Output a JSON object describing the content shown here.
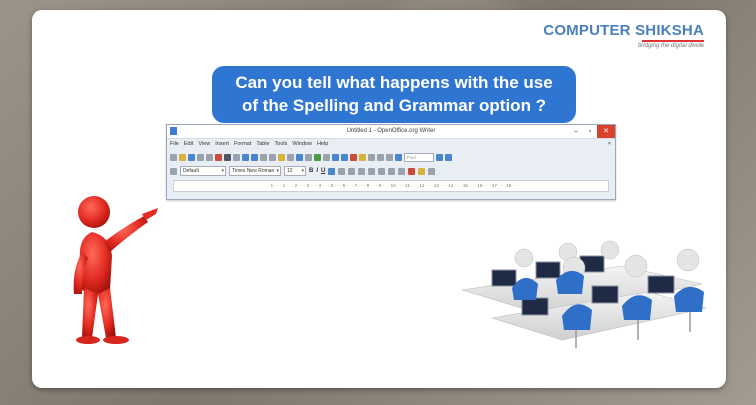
{
  "logo": {
    "main": "COMPUTER SHIKSHA",
    "tagline": "bridging the digital divide"
  },
  "question": {
    "line1": "Can you tell what happens with the use",
    "line2": "of the Spelling and Grammar option ?"
  },
  "writer": {
    "title": "Untitled 1 - OpenOffice.org Writer",
    "menu": [
      "File",
      "Edit",
      "View",
      "Insert",
      "Format",
      "Table",
      "Tools",
      "Window",
      "Help"
    ],
    "find_placeholder": "Find",
    "paragraph_style": "Default",
    "font_name": "Times New Roman",
    "font_size": "12",
    "ruler": "· · 1 · · · 1 · · · 2 · · · 3 · · · 4 · · · 5 · · · 6 · · · 7 · · · 8 · · · 9 · · · 10 · · · 11 · · · 12 · · · 13 · · · 14 · · · 15 · · · 16 · · · 17 · · · 18 · ·"
  },
  "colors": {
    "question_bg": "#2f76d2",
    "logo_blue": "#1d5aa6",
    "figure_red": "#e22b22",
    "close_red": "#d9412c"
  }
}
